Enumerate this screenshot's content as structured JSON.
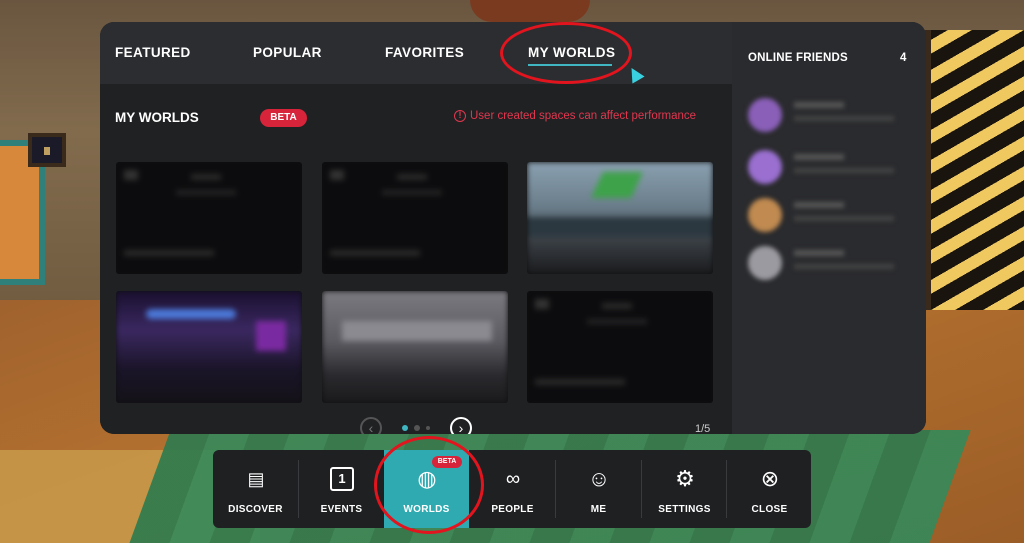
{
  "tabs": [
    "FEATURED",
    "POPULAR",
    "FAVORITES",
    "MY WORLDS"
  ],
  "active_tab": "MY WORLDS",
  "section": {
    "title": "MY WORLDS",
    "badge": "BETA",
    "warning": "User created spaces can affect performance",
    "warning_icon": "!"
  },
  "cards": [
    {
      "name": "world-card-1",
      "theme": "dark"
    },
    {
      "name": "world-card-2",
      "theme": "dark"
    },
    {
      "name": "world-card-3",
      "theme": "image"
    },
    {
      "name": "world-card-4",
      "theme": "purple"
    },
    {
      "name": "world-card-5",
      "theme": "gray"
    },
    {
      "name": "world-card-6",
      "theme": "dark"
    }
  ],
  "pager": {
    "prev": "‹",
    "next": "›",
    "page_label": "1/5",
    "active_dot": 1,
    "dots": 3
  },
  "friends": {
    "title": "ONLINE FRIENDS",
    "count": "4",
    "avatar_colors": [
      "#8a5fb8",
      "#9a6fd0",
      "#c08a50",
      "#9a9aa0"
    ]
  },
  "dock": [
    {
      "label": "DISCOVER",
      "icon": "discover-icon",
      "glyph": "▤"
    },
    {
      "label": "EVENTS",
      "icon": "calendar-icon",
      "glyph": "1"
    },
    {
      "label": "WORLDS",
      "icon": "globe-icon",
      "glyph": "◍",
      "badge": "BETA",
      "active": true
    },
    {
      "label": "PEOPLE",
      "icon": "people-icon",
      "glyph": "∞"
    },
    {
      "label": "ME",
      "icon": "smiley-icon",
      "glyph": "☺"
    },
    {
      "label": "SETTINGS",
      "icon": "gear-icon",
      "glyph": "⚙"
    },
    {
      "label": "CLOSE",
      "icon": "close-icon",
      "glyph": "⊗"
    }
  ],
  "colors": {
    "accent": "#3fb6c2",
    "dock_active": "#2eaab0",
    "beta": "#d8243a",
    "warning": "#e0374e",
    "annotation": "#e2141e"
  }
}
